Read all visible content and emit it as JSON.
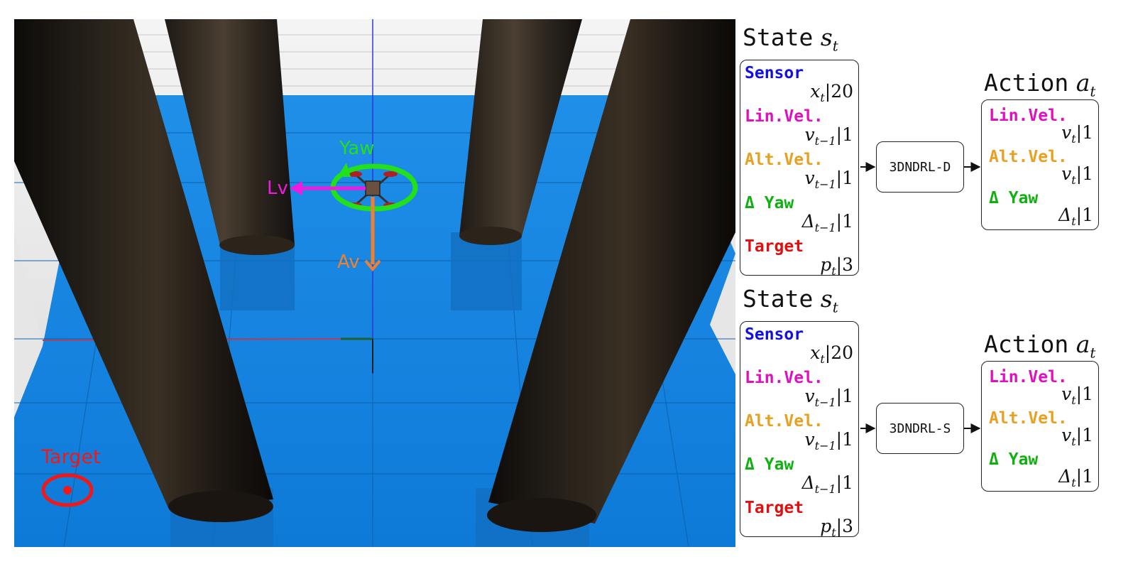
{
  "scene": {
    "labels": {
      "yaw": "Yaw",
      "linear": "Lv",
      "altitude": "Av",
      "target": "Target"
    },
    "colors": {
      "floor": "#1a8de6",
      "yaw": "#22e01a",
      "linear": "#f01ae0",
      "altitude": "#f08030",
      "target": "#f01818"
    }
  },
  "panels": [
    {
      "state_title": "State",
      "state_symbol": "s",
      "state_sub": "t",
      "inputs": [
        {
          "label": "Sensor",
          "value": "x",
          "sub": "t",
          "dim": "|20",
          "color": "#1010e0"
        },
        {
          "label": "Lin.Vel.",
          "value": "v",
          "sub": "t−1",
          "dim": "|1",
          "color": "#e010c0"
        },
        {
          "label": "Alt.Vel.",
          "value": "v",
          "sub": "t−1",
          "dim": "|1",
          "color": "#e8a020"
        },
        {
          "label": "Δ Yaw",
          "value": "Δ",
          "sub": "t−1",
          "dim": "|1",
          "color": "#10b010"
        },
        {
          "label": "Target",
          "value": "p",
          "sub": "t",
          "dim": "|3",
          "color": "#e01010"
        }
      ],
      "model": "3DNDRL-D",
      "action_title": "Action",
      "action_symbol": "a",
      "action_sub": "t",
      "outputs": [
        {
          "label": "Lin.Vel.",
          "value": "v",
          "sub": "t",
          "dim": "|1",
          "color": "#e010c0"
        },
        {
          "label": "Alt.Vel.",
          "value": "v",
          "sub": "t",
          "dim": "|1",
          "color": "#e8a020"
        },
        {
          "label": "Δ Yaw",
          "value": "Δ",
          "sub": "t",
          "dim": "|1",
          "color": "#10b010"
        }
      ]
    },
    {
      "state_title": "State",
      "state_symbol": "s",
      "state_sub": "t",
      "inputs": [
        {
          "label": "Sensor",
          "value": "x",
          "sub": "t",
          "dim": "|20",
          "color": "#1010e0"
        },
        {
          "label": "Lin.Vel.",
          "value": "v",
          "sub": "t−1",
          "dim": "|1",
          "color": "#e010c0"
        },
        {
          "label": "Alt.Vel.",
          "value": "v",
          "sub": "t−1",
          "dim": "|1",
          "color": "#e8a020"
        },
        {
          "label": "Δ Yaw",
          "value": "Δ",
          "sub": "t−1",
          "dim": "|1",
          "color": "#10b010"
        },
        {
          "label": "Target",
          "value": "p",
          "sub": "t",
          "dim": "|3",
          "color": "#e01010"
        }
      ],
      "model": "3DNDRL-S",
      "action_title": "Action",
      "action_symbol": "a",
      "action_sub": "t",
      "outputs": [
        {
          "label": "Lin.Vel.",
          "value": "v",
          "sub": "t",
          "dim": "|1",
          "color": "#e010c0"
        },
        {
          "label": "Alt.Vel.",
          "value": "v",
          "sub": "t",
          "dim": "|1",
          "color": "#e8a020"
        },
        {
          "label": "Δ Yaw",
          "value": "Δ",
          "sub": "t",
          "dim": "|1",
          "color": "#10b010"
        }
      ]
    }
  ]
}
